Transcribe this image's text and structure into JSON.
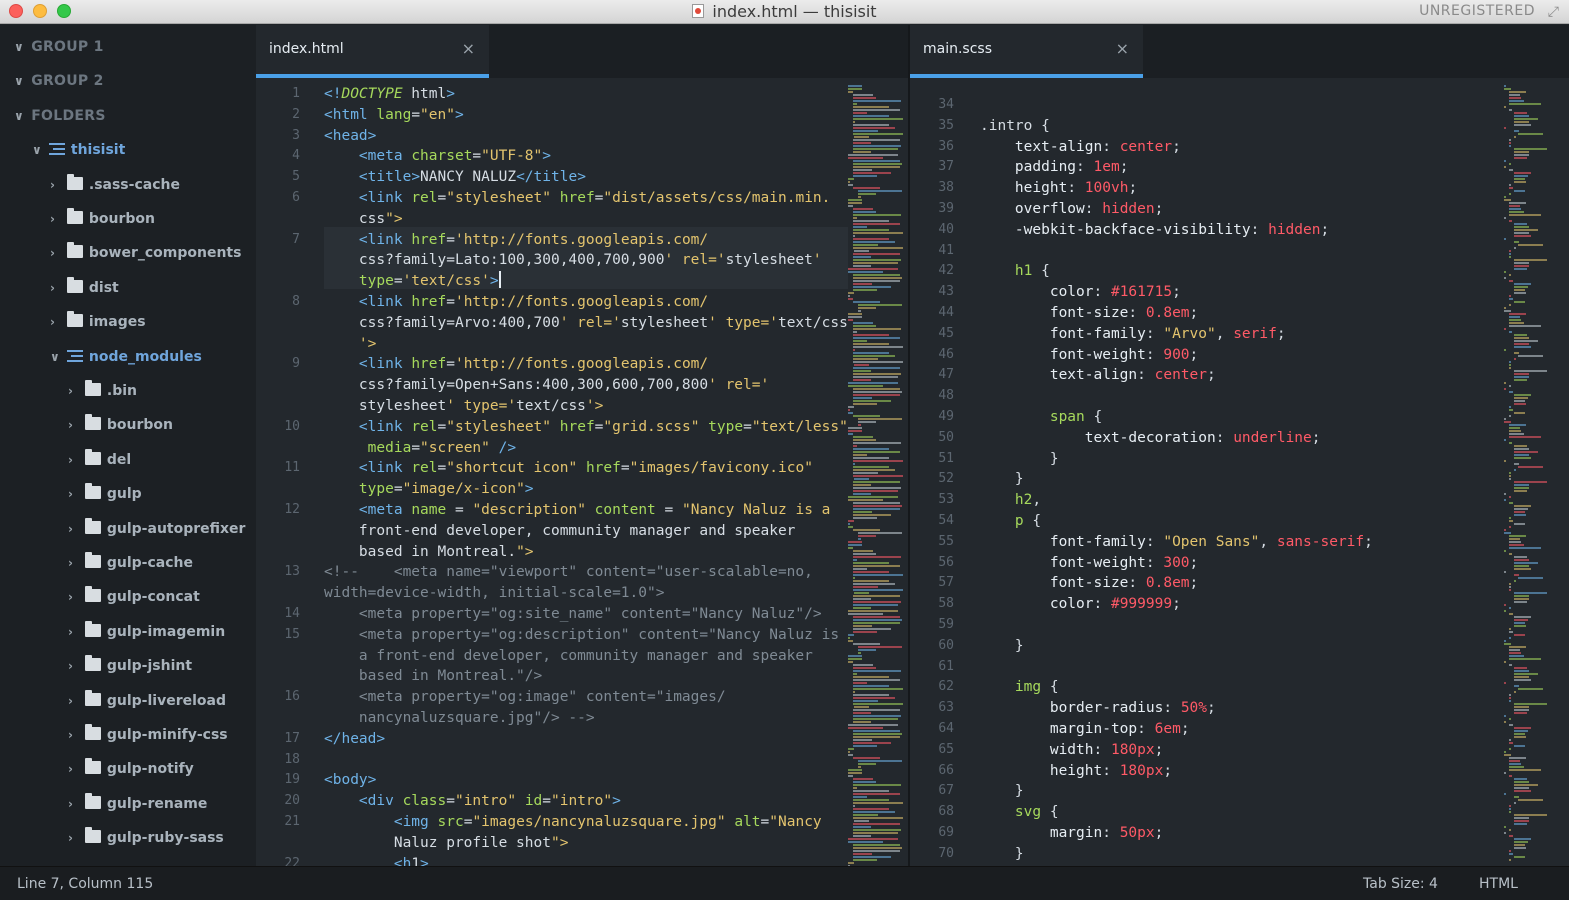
{
  "window": {
    "title": "index.html — thisisit",
    "registration": "UNREGISTERED"
  },
  "sidebar": {
    "groups": [
      "GROUP 1",
      "GROUP 2",
      "FOLDERS"
    ],
    "project": "thisisit",
    "project_folders": [
      ".sass-cache",
      "bourbon",
      "bower_components",
      "dist",
      "images",
      "node_modules"
    ],
    "node_modules": [
      ".bin",
      "bourbon",
      "del",
      "gulp",
      "gulp-autoprefixer",
      "gulp-cache",
      "gulp-concat",
      "gulp-imagemin",
      "gulp-jshint",
      "gulp-livereload",
      "gulp-minify-css",
      "gulp-notify",
      "gulp-rename",
      "gulp-ruby-sass"
    ]
  },
  "left_editor": {
    "tab": "index.html",
    "close": "×",
    "line_numbers": [
      "1",
      "2",
      "3",
      "4",
      "5",
      "6",
      "",
      "7",
      "",
      "",
      "8",
      "",
      "",
      "9",
      "",
      "",
      "10",
      "",
      "11",
      "",
      "12",
      "",
      "",
      "13",
      "",
      "14",
      "15",
      "",
      "",
      "16",
      "",
      "17",
      "18",
      "19",
      "20",
      "21",
      "",
      "22"
    ],
    "lines": [
      "<!DOCTYPE html>",
      "<html lang=\"en\">",
      "<head>",
      "    <meta charset=\"UTF-8\">",
      "    <title>NANCY NALUZ</title>",
      "    <link rel=\"stylesheet\" href=\"dist/assets/css/main.min.",
      "    css\">",
      "    <link href='http://fonts.googleapis.com/",
      "    css?family=Lato:100,300,400,700,900' rel='stylesheet'",
      "    type='text/css'>",
      "    <link href='http://fonts.googleapis.com/",
      "    css?family=Arvo:400,700' rel='stylesheet' type='text/css",
      "    '>",
      "    <link href='http://fonts.googleapis.com/",
      "    css?family=Open+Sans:400,300,600,700,800' rel='",
      "    stylesheet' type='text/css'>",
      "    <link rel=\"stylesheet\" href=\"grid.scss\" type=\"text/less\"",
      "     media=\"screen\" />",
      "    <link rel=\"shortcut icon\" href=\"images/favicony.ico\"",
      "    type=\"image/x-icon\">",
      "    <meta name = \"description\" content = \"Nancy Naluz is a",
      "    front-end developer, community manager and speaker",
      "    based in Montreal.\">",
      "<!--    <meta name=\"viewport\" content=\"user-scalable=no,",
      "width=device-width, initial-scale=1.0\">",
      "    <meta property=\"og:site_name\" content=\"Nancy Naluz\"/>",
      "    <meta property=\"og:description\" content=\"Nancy Naluz is",
      "    a front-end developer, community manager and speaker",
      "    based in Montreal.\"/>",
      "    <meta property=\"og:image\" content=\"images/",
      "    nancynaluzsquare.jpg\"/> -->",
      "</head>",
      "",
      "<body>",
      "    <div class=\"intro\" id=\"intro\">",
      "        <img src=\"images/nancynaluzsquare.jpg\" alt=\"Nancy",
      "        Naluz profile shot\">",
      "        <h1>"
    ]
  },
  "right_editor": {
    "tab": "main.scss",
    "close": "×",
    "line_numbers": [
      "34",
      "35",
      "36",
      "37",
      "38",
      "39",
      "40",
      "41",
      "42",
      "43",
      "44",
      "45",
      "46",
      "47",
      "48",
      "49",
      "50",
      "51",
      "52",
      "53",
      "54",
      "55",
      "56",
      "57",
      "58",
      "59",
      "60",
      "61",
      "62",
      "63",
      "64",
      "65",
      "66",
      "67",
      "68",
      "69",
      "70"
    ],
    "lines": [
      "",
      ".intro {",
      "    text-align: center;",
      "    padding: 1em;",
      "    height: 100vh;",
      "    overflow: hidden;",
      "    -webkit-backface-visibility: hidden;",
      "",
      "    h1 {",
      "        color: #161715;",
      "        font-size: 0.8em;",
      "        font-family: \"Arvo\", serif;",
      "        font-weight: 900;",
      "        text-align: center;",
      "",
      "        span {",
      "            text-decoration: underline;",
      "        }",
      "    }",
      "    h2,",
      "    p {",
      "        font-family: \"Open Sans\", sans-serif;",
      "        font-weight: 300;",
      "        font-size: 0.8em;",
      "        color: #999999;",
      "",
      "    }",
      "",
      "    img {",
      "        border-radius: 50%;",
      "        margin-top: 6em;",
      "        width: 180px;",
      "        height: 180px;",
      "    }",
      "    svg {",
      "        margin: 50px;",
      "    }"
    ]
  },
  "status": {
    "position": "Line 7, Column 115",
    "tab_size": "Tab Size: 4",
    "syntax": "HTML"
  },
  "colors": {
    "tag": "#6fb3e8",
    "attr": "#a6d95c",
    "string": "#e3c46e",
    "keyword": "#ff5a67",
    "comment": "#7f8a94",
    "accent": "#4aa0e8"
  }
}
